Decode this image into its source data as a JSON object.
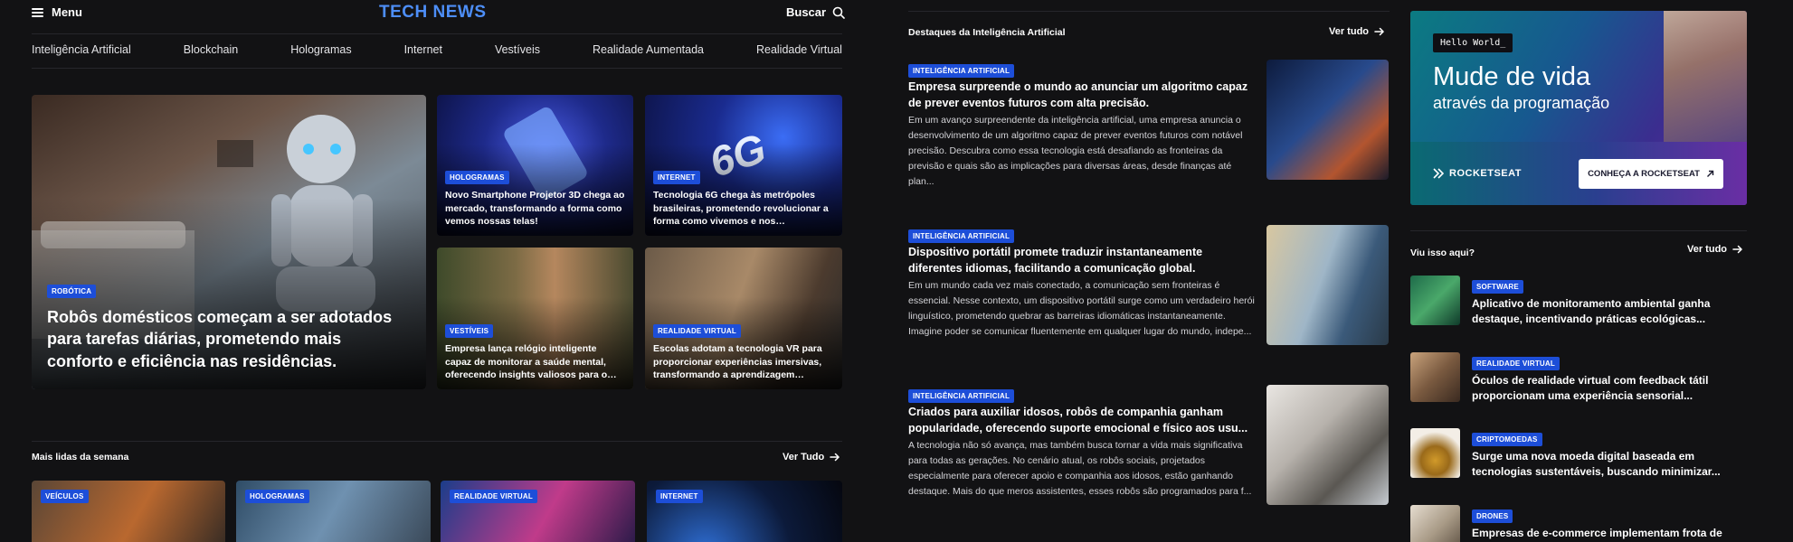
{
  "header": {
    "menu_label": "Menu",
    "logo": "TECH NEWS",
    "search_label": "Buscar"
  },
  "nav": {
    "items": [
      "Inteligência Artificial",
      "Blockchain",
      "Hologramas",
      "Internet",
      "Vestíveis",
      "Realidade Aumentada",
      "Realidade Virtual"
    ]
  },
  "hero": {
    "main": {
      "tag": "ROBÓTICA",
      "title": "Robôs domésticos começam a ser adotados para tarefas diárias, prometendo mais conforto e eficiência nas residências."
    },
    "cards": [
      {
        "tag": "HOLOGRAMAS",
        "title": "Novo Smartphone Projetor 3D chega ao mercado, transformando a forma como vemos nossas telas!"
      },
      {
        "tag": "INTERNET",
        "title": "Tecnologia 6G chega às metrópoles brasileiras, prometendo revolucionar a forma como vivemos e nos comunicamos."
      },
      {
        "tag": "VESTÍVEIS",
        "title": "Empresa lança relógio inteligente capaz de monitorar a saúde mental, oferecendo insights valiosos para o bem-estar."
      },
      {
        "tag": "REALIDADE VIRTUAL",
        "title": "Escolas adotam a tecnologia VR para proporcionar experiências imersivas, transformando a aprendizagem tradicional."
      }
    ]
  },
  "most_read": {
    "title": "Mais lidas da semana",
    "see_all": "Ver Tudo",
    "items": [
      {
        "tag": "VEÍCULOS"
      },
      {
        "tag": "HOLOGRAMAS"
      },
      {
        "tag": "REALIDADE VIRTUAL"
      },
      {
        "tag": "INTERNET"
      }
    ]
  },
  "featured": {
    "title": "Destaques da Inteligência Artificial",
    "see_all": "Ver tudo",
    "items": [
      {
        "tag": "INTELIGÊNCIA ARTIFICIAL",
        "title": "Empresa surpreende o mundo ao anunciar um algoritmo capaz de prever eventos futuros com alta precisão.",
        "text": "Em um avanço surpreendente da inteligência artificial, uma empresa anuncia o desenvolvimento de um algoritmo capaz de prever eventos futuros com notável precisão. Descubra como essa tecnologia está desafiando as fronteiras da previsão e quais são as implicações para diversas áreas, desde finanças até plan..."
      },
      {
        "tag": "INTELIGÊNCIA ARTIFICIAL",
        "title": "Dispositivo portátil promete traduzir instantaneamente diferentes idiomas, facilitando a comunicação global.",
        "text": "Em um mundo cada vez mais conectado, a comunicação sem fronteiras é essencial. Nesse contexto, um dispositivo portátil surge como um verdadeiro herói linguístico, prometendo quebrar as barreiras idiomáticas instantaneamente. Imagine poder se comunicar fluentemente em qualquer lugar do mundo, indepe..."
      },
      {
        "tag": "INTELIGÊNCIA ARTIFICIAL",
        "title": "Criados para auxiliar idosos, robôs de companhia ganham popularidade, oferecendo suporte emocional e físico aos usu...",
        "text": "A tecnologia não só avança, mas também busca tornar a vida mais significativa para todas as gerações. No cenário atual, os robôs sociais, projetados especialmente para oferecer apoio e companhia aos idosos, estão ganhando destaque. Mais do que meros assistentes, esses robôs são programados para f..."
      }
    ]
  },
  "ad": {
    "code_label": "Hello World_",
    "headline": "Mude de vida",
    "subline": "através da programação",
    "brand": "ROCKETSEAT",
    "cta": "CONHEÇA A ROCKETSEAT"
  },
  "sidebar": {
    "title": "Viu isso aqui?",
    "see_all": "Ver tudo",
    "items": [
      {
        "tag": "SOFTWARE",
        "title": "Aplicativo de monitoramento ambiental ganha destaque, incentivando práticas ecológicas..."
      },
      {
        "tag": "REALIDADE VIRTUAL",
        "title": "Óculos de realidade virtual com feedback tátil proporcionam uma experiência sensorial..."
      },
      {
        "tag": "CRIPTOMOEDAS",
        "title": "Surge uma nova moeda digital baseada em tecnologias sustentáveis, buscando minimizar..."
      },
      {
        "tag": "DRONES",
        "title": "Empresas de e-commerce implementam frota de"
      }
    ]
  },
  "colors": {
    "background": "#121214",
    "logo": "#4d8ef7",
    "tag": "#1d4ed8"
  }
}
